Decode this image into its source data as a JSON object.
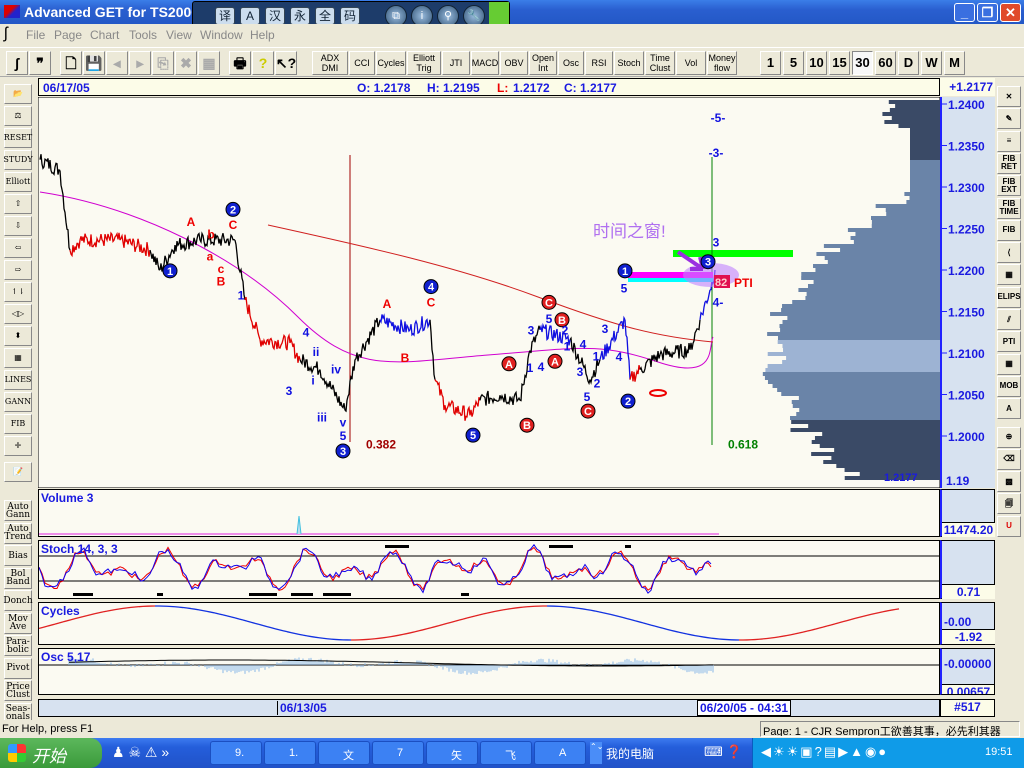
{
  "window": {
    "title": "Advanced GET for TS2000i"
  },
  "ime": {
    "keys": [
      "译",
      "A",
      "汉",
      "永",
      "全",
      "码"
    ],
    "round": [
      "⧉",
      "i",
      "⚲",
      "🔧"
    ]
  },
  "menu": [
    "File",
    "Page",
    "Chart",
    "Tools",
    "View",
    "Window",
    "Help"
  ],
  "toolbar": {
    "studies": [
      "ADX DMI",
      "CCI",
      "Cycles",
      "Elliott Trig",
      "JTI",
      "MACD",
      "OBV",
      "Open Int",
      "Osc",
      "RSI",
      "Stoch",
      "Time Clust",
      "Vol",
      "Money flow"
    ],
    "intervals": [
      "1",
      "5",
      "10",
      "15",
      "30",
      "60",
      "D",
      "W",
      "M"
    ],
    "active_interval": "30"
  },
  "left_tools": [
    "📂",
    "⚖",
    "RESET",
    "STUDY",
    "Elliott",
    "⇧",
    "⇩",
    "⇦",
    "⇨",
    "↿⇂",
    "◁▷",
    "⬍",
    "▦",
    "LINES",
    "GANN",
    "FIB",
    "✛",
    "📝"
  ],
  "left_studies": [
    "Auto Gann",
    "Auto Trend",
    "Bias",
    "Bol Band",
    "Donch",
    "Mov Ave",
    "Para-bolic",
    "Pivot",
    "Price Clust",
    "Seas-onals"
  ],
  "right_tools": [
    "✕",
    "✎",
    "≡",
    "FIB RET",
    "FIB EXT",
    "FIB TIME",
    "FIB",
    "⟨",
    "▦",
    "ELIPS",
    "⫽",
    "PTI",
    "▦",
    "MOB",
    "A",
    "⊕",
    "⌫",
    "▩",
    "🗐",
    "U"
  ],
  "info": {
    "date": "06/17/05",
    "open": "O: 1.2178",
    "high": "H: 1.2195",
    "low_label": "L:",
    "low": "1.2172",
    "close": "C: 1.2177",
    "last": "+1.2177"
  },
  "chart_data": {
    "type": "line",
    "price_ticks": [
      "1.2400",
      "1.2350",
      "1.2300",
      "1.2250",
      "1.2200",
      "1.2150",
      "1.2100",
      "1.2050",
      "1.2000"
    ],
    "ylim": [
      1.1935,
      1.2405
    ],
    "last_price": "1.2177",
    "axis_bottom": "1.19",
    "price_path": [
      [
        0,
        1.2333,
        "k"
      ],
      [
        20,
        1.232,
        "k"
      ],
      [
        30,
        1.2224,
        "r"
      ],
      [
        40,
        1.2236,
        "r"
      ],
      [
        80,
        1.2236,
        "r"
      ],
      [
        110,
        1.2224,
        "k"
      ],
      [
        120,
        1.22,
        "k"
      ],
      [
        135,
        1.223,
        "k"
      ],
      [
        160,
        1.2236,
        "k"
      ],
      [
        195,
        1.2236,
        "k"
      ],
      [
        205,
        1.2164,
        "r"
      ],
      [
        220,
        1.2116,
        "r"
      ],
      [
        250,
        1.2112,
        "r"
      ],
      [
        260,
        1.2092,
        "k"
      ],
      [
        280,
        1.208,
        "k"
      ],
      [
        305,
        1.2031,
        "k"
      ],
      [
        315,
        1.2092,
        "k"
      ],
      [
        340,
        1.214,
        "b"
      ],
      [
        370,
        1.2128,
        "b"
      ],
      [
        390,
        1.214,
        "k"
      ],
      [
        395,
        1.2068,
        "r"
      ],
      [
        405,
        1.2037,
        "r"
      ],
      [
        430,
        1.2025,
        "r"
      ],
      [
        440,
        1.2043,
        "k"
      ],
      [
        460,
        1.2049,
        "k"
      ],
      [
        480,
        1.2043,
        "k"
      ],
      [
        490,
        1.2103,
        "k"
      ],
      [
        500,
        1.2128,
        "b"
      ],
      [
        530,
        1.2116,
        "k"
      ],
      [
        550,
        1.2068,
        "k"
      ],
      [
        560,
        1.2092,
        "b"
      ],
      [
        585,
        1.214,
        "b"
      ],
      [
        590,
        1.2068,
        "r"
      ],
      [
        600,
        1.208,
        "k"
      ],
      [
        620,
        1.2098,
        "k"
      ],
      [
        650,
        1.2104,
        "k"
      ],
      [
        660,
        1.214,
        "b"
      ],
      [
        670,
        1.2176,
        "b"
      ],
      [
        675,
        1.22,
        "b"
      ]
    ],
    "wave_labels": [
      {
        "t": "1",
        "s": "cb",
        "bar": 130,
        "price": 1.2199
      },
      {
        "t": "2",
        "s": "cb",
        "bar": 193,
        "price": 1.2273
      },
      {
        "t": "3",
        "s": "cb",
        "bar": 303,
        "price": 1.1982
      },
      {
        "t": "4",
        "s": "cb",
        "bar": 391,
        "price": 1.218
      },
      {
        "t": "5",
        "s": "cb",
        "bar": 433,
        "price": 1.2001
      },
      {
        "t": "1",
        "s": "cb",
        "bar": 585,
        "price": 1.2199
      },
      {
        "t": "2",
        "s": "cb",
        "bar": 588,
        "price": 1.2042
      },
      {
        "t": "3",
        "s": "cb",
        "bar": 668,
        "price": 1.221
      },
      {
        "t": "C",
        "s": "cr",
        "bar": 509,
        "price": 1.2161
      },
      {
        "t": "B",
        "s": "cr",
        "bar": 522,
        "price": 1.214
      },
      {
        "t": "A",
        "s": "cr",
        "bar": 469,
        "price": 1.2087
      },
      {
        "t": "A",
        "s": "cr",
        "bar": 515,
        "price": 1.209
      },
      {
        "t": "B",
        "s": "cr",
        "bar": 487,
        "price": 1.2013
      },
      {
        "t": "C",
        "s": "cr",
        "bar": 548,
        "price": 1.203
      },
      {
        "t": "A",
        "s": "r",
        "bar": 151,
        "price": 1.2258
      },
      {
        "t": "b",
        "s": "r",
        "bar": 171,
        "price": 1.2243
      },
      {
        "t": "a",
        "s": "r",
        "bar": 170,
        "price": 1.2216
      },
      {
        "t": "C",
        "s": "r",
        "bar": 193,
        "price": 1.2254
      },
      {
        "t": "c",
        "s": "r",
        "bar": 181,
        "price": 1.2201
      },
      {
        "t": "B",
        "s": "r",
        "bar": 181,
        "price": 1.2186
      },
      {
        "t": "A",
        "s": "r",
        "bar": 347,
        "price": 1.2159
      },
      {
        "t": "C",
        "s": "r",
        "bar": 391,
        "price": 1.2161
      },
      {
        "t": "B",
        "s": "r",
        "bar": 365,
        "price": 1.2094
      },
      {
        "t": "1",
        "s": "b",
        "bar": 201,
        "price": 1.2169
      },
      {
        "t": "4",
        "s": "b",
        "bar": 266,
        "price": 1.2125
      },
      {
        "t": "ii",
        "s": "b",
        "bar": 276,
        "price": 1.2101
      },
      {
        "t": "3",
        "s": "b",
        "bar": 249,
        "price": 1.2054
      },
      {
        "t": "i",
        "s": "b",
        "bar": 273,
        "price": 1.2067
      },
      {
        "t": "iv",
        "s": "b",
        "bar": 296,
        "price": 1.208
      },
      {
        "t": "iii",
        "s": "b",
        "bar": 282,
        "price": 1.2022
      },
      {
        "t": "v",
        "s": "b",
        "bar": 303,
        "price": 1.2016
      },
      {
        "t": "5",
        "s": "b",
        "bar": 303,
        "price": 1.2
      },
      {
        "t": "1",
        "s": "b",
        "bar": 490,
        "price": 1.2082
      },
      {
        "t": "4",
        "s": "b",
        "bar": 501,
        "price": 1.2083
      },
      {
        "t": "3",
        "s": "b",
        "bar": 491,
        "price": 1.2127
      },
      {
        "t": "5",
        "s": "b",
        "bar": 509,
        "price": 1.2141
      },
      {
        "t": "2",
        "s": "b",
        "bar": 525,
        "price": 1.2127
      },
      {
        "t": "1",
        "s": "b",
        "bar": 527,
        "price": 1.2108
      },
      {
        "t": "4",
        "s": "b",
        "bar": 543,
        "price": 1.211
      },
      {
        "t": "3",
        "s": "b",
        "bar": 540,
        "price": 1.2077
      },
      {
        "t": "2",
        "s": "b",
        "bar": 557,
        "price": 1.2063
      },
      {
        "t": "5",
        "s": "b",
        "bar": 547,
        "price": 1.2047
      },
      {
        "t": "1",
        "s": "b",
        "bar": 556,
        "price": 1.2096
      },
      {
        "t": "3",
        "s": "b",
        "bar": 565,
        "price": 1.2129
      },
      {
        "t": "4",
        "s": "b",
        "bar": 579,
        "price": 1.2095
      },
      {
        "t": "5",
        "s": "b",
        "bar": 584,
        "price": 1.2178
      },
      {
        "t": "-5-",
        "s": "b",
        "bar": 678,
        "price": 1.2383
      },
      {
        "t": "-3-",
        "s": "b",
        "bar": 676,
        "price": 1.2341
      },
      {
        "t": "3",
        "s": "b",
        "bar": 676,
        "price": 1.2233
      },
      {
        "t": "4-",
        "s": "b",
        "bar": 678,
        "price": 1.2161
      }
    ],
    "fib_labels": [
      {
        "t": "0.382",
        "color": "#a00000",
        "bar": 326,
        "price": 1.199
      },
      {
        "t": "0.618",
        "color": "#008000",
        "bar": 688,
        "price": 1.199
      }
    ],
    "annotation": "时间之窗!",
    "pti": {
      "value": "82",
      "label": "PTI"
    }
  },
  "panels": {
    "volume": {
      "title": "Volume 3",
      "value": "11474.20"
    },
    "stoch": {
      "title": "Stoch 14, 3, 3",
      "value": "0.71"
    },
    "cycles": {
      "title": "Cycles",
      "value1": "-0.00",
      "value2": "-1.92"
    },
    "osc": {
      "title": "Osc 5,17",
      "value1": "-0.00000",
      "value2": "0.00657"
    }
  },
  "datebar": {
    "start": "06/13/05",
    "cursor": "06/20/05 - 04:31",
    "bars": "#517"
  },
  "status": {
    "help": "For Help, press F1",
    "page": "Page: 1 - CJR Sempron工欲善其事，必先利其器"
  },
  "taskbar": {
    "start": "开始",
    "tasks": [
      "9.",
      "1.",
      "文",
      "7",
      "矢",
      "飞",
      "A"
    ],
    "mycomputer": "我的电脑",
    "clock": "19:51"
  }
}
